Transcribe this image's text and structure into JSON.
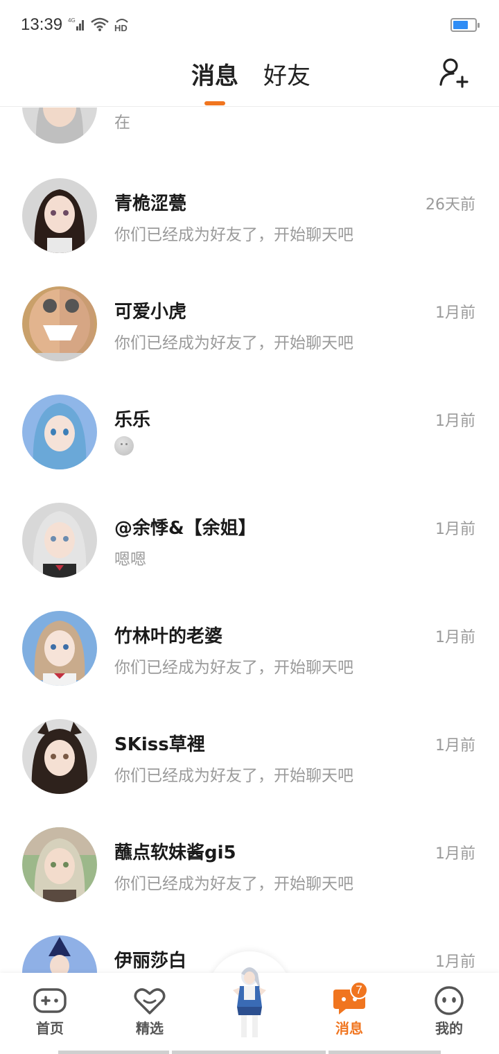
{
  "status_bar": {
    "time": "13:39",
    "network": "4G",
    "hd": "HD",
    "battery_color": "#2f8df5"
  },
  "header": {
    "tabs": [
      {
        "label": "消息",
        "active": true
      },
      {
        "label": "好友",
        "active": false
      }
    ],
    "accent": "#f0751f",
    "add_friend_icon": "add-user-icon"
  },
  "conversations": [
    {
      "name": "",
      "preview": "在",
      "time": ""
    },
    {
      "name": "青桅涩甍",
      "preview": "你们已经成为好友了，开始聊天吧",
      "time": "26天前"
    },
    {
      "name": "可爱小虎",
      "preview": "你们已经成为好友了，开始聊天吧",
      "time": "1月前"
    },
    {
      "name": "乐乐",
      "preview": "",
      "time": "1月前",
      "preview_icon": "smiley-emoji-icon"
    },
    {
      "name": "@余悸&【余姐】",
      "preview": "嗯嗯",
      "time": "1月前"
    },
    {
      "name": "竹林叶的老婆",
      "preview": "你们已经成为好友了，开始聊天吧",
      "time": "1月前"
    },
    {
      "name": "SKiss草裡",
      "preview": "你们已经成为好友了，开始聊天吧",
      "time": "1月前"
    },
    {
      "name": "蘸点软妹酱gi5",
      "preview": "你们已经成为好友了，开始聊天吧",
      "time": "1月前"
    },
    {
      "name": "伊丽莎白",
      "preview": "",
      "time": "1月前"
    }
  ],
  "bottom_nav": {
    "items": [
      {
        "label": "首页",
        "icon": "gamepad-icon"
      },
      {
        "label": "精选",
        "icon": "heart-chat-icon"
      },
      {
        "label": "消息",
        "icon": "message-bubble-icon",
        "badge": "7",
        "active": true
      },
      {
        "label": "我的",
        "icon": "face-icon"
      }
    ]
  }
}
